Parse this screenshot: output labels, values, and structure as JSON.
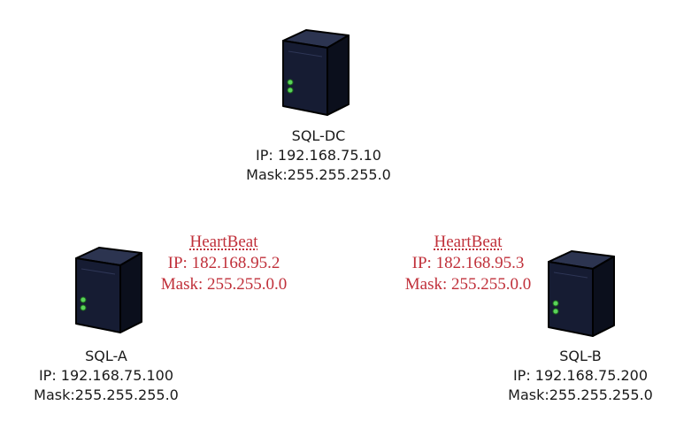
{
  "colors": {
    "heartbeat_text": "#c0303a",
    "server_body": "#141a2e",
    "server_edge": "#000000",
    "led": "#5ad45a"
  },
  "icons": {
    "server": "server-tower-icon"
  },
  "nodes": {
    "dc": {
      "name": "SQL-DC",
      "ip": "IP: 192.168.75.10",
      "mask": "Mask:255.255.255.0"
    },
    "a": {
      "name": "SQL-A",
      "ip": "IP: 192.168.75.100",
      "mask": "Mask:255.255.255.0",
      "heartbeat": {
        "title": "HeartBeat",
        "ip": "IP: 182.168.95.2",
        "mask": "Mask: 255.255.0.0"
      }
    },
    "b": {
      "name": "SQL-B",
      "ip": "IP: 192.168.75.200",
      "mask": "Mask:255.255.255.0",
      "heartbeat": {
        "title": "HeartBeat",
        "ip": "IP: 182.168.95.3",
        "mask": "Mask: 255.255.0.0"
      }
    }
  }
}
